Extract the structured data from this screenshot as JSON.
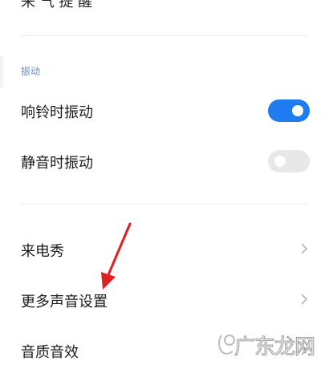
{
  "top_cut_label": "来 气 提 醒",
  "vibration_section": {
    "title": "振动",
    "ring_vibrate": {
      "label": "响铃时振动",
      "on": true
    },
    "silent_vibrate": {
      "label": "静音时振动",
      "on": false
    }
  },
  "rows": [
    {
      "label": "来电秀"
    },
    {
      "label": "更多声音设置"
    },
    {
      "label": "音质音效"
    }
  ],
  "watermark_text": "广东龙网",
  "colors": {
    "accent": "#1e7cf0",
    "arrow": "#e02020",
    "section_label": "#6d8fbf"
  }
}
